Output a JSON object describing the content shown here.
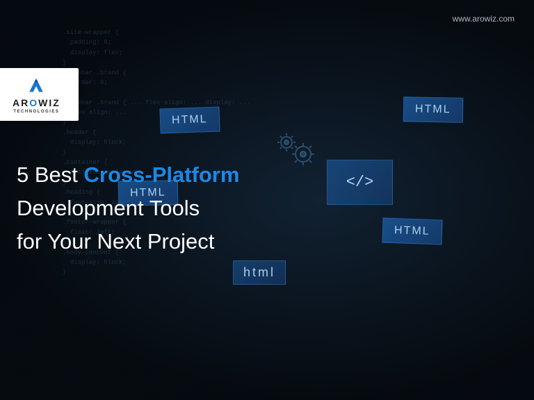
{
  "url": "www.arowiz.com",
  "logo": {
    "name_first": "AR",
    "name_accent": "O",
    "name_last": "WIZ",
    "tagline": "TECHNOLOGIES"
  },
  "headline": {
    "line1_prefix": "5 Best ",
    "line1_highlight": "Cross-Platform",
    "line2": "Development Tools",
    "line3": "for Your Next Project"
  },
  "badges": {
    "html": "HTML",
    "html_lower": "html",
    "code_symbol": "</>"
  },
  "code_bg": ".site-wrapper {\n  padding: 0;\n  display: flex;\n}\n.sidebar .brand {\n  border: 0;\n}\n.sidebar .brand { ... flex align: ... display: ...\n  flex align: ...\n}\n.header {\n  display: block;\n}\n.container {\n  position: relative;\n}\n.heading {\n  font-size: 14px;\n}\n.footer-wrapper {\n  float: left;\n}\n.body-content {\n  display: block;\n}"
}
